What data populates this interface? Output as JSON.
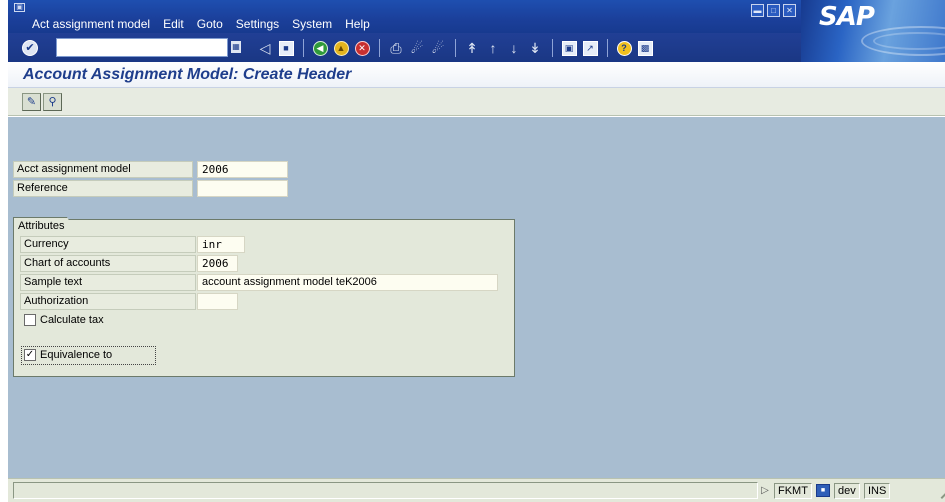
{
  "menu": {
    "items": [
      "Act assignment model",
      "Edit",
      "Goto",
      "Settings",
      "System",
      "Help"
    ],
    "logo_text": "SAP"
  },
  "toolbar": {
    "command_field_value": ""
  },
  "page": {
    "title": "Account Assignment Model: Create Header"
  },
  "header_fields": {
    "model_label": "Acct assignment model",
    "model_value": "2006",
    "reference_label": "Reference",
    "reference_value": ""
  },
  "attributes": {
    "group_title": "Attributes",
    "currency_label": "Currency",
    "currency_value": "inr",
    "chart_label": "Chart of accounts",
    "chart_value": "2006",
    "sample_label": "Sample text",
    "sample_value": "account assignment model teK2006",
    "authorization_label": "Authorization",
    "authorization_value": "",
    "calculate_tax_label": "Calculate tax",
    "calculate_tax_checked": false,
    "equivalence_label": "Equivalence to",
    "equivalence_checked": true
  },
  "status": {
    "transaction": "FKMT",
    "user": "dev",
    "mode": "INS"
  },
  "colors": {
    "menubar": "#1b3f9a",
    "title_text": "#1f3e8c",
    "main_background": "#a8bdd0",
    "field_label_bg": "#e8ecdf",
    "field_value_bg": "#fdfdf1"
  },
  "icons": {
    "enter": "check-icon",
    "save": "save-icon",
    "back": "back-icon",
    "exit": "exit-icon",
    "cancel": "cancel-icon",
    "print": "print-icon",
    "find": "find-icon",
    "find_next": "find-next-icon",
    "first_page": "first-page-icon",
    "prev_page": "prev-page-icon",
    "next_page": "next-page-icon",
    "last_page": "last-page-icon",
    "new_session": "new-session-icon",
    "shortcut": "shortcut-icon",
    "help": "help-icon",
    "layout": "layout-icon",
    "edit_screen": "pencil-icon",
    "display_screen": "magnifier-icon"
  }
}
